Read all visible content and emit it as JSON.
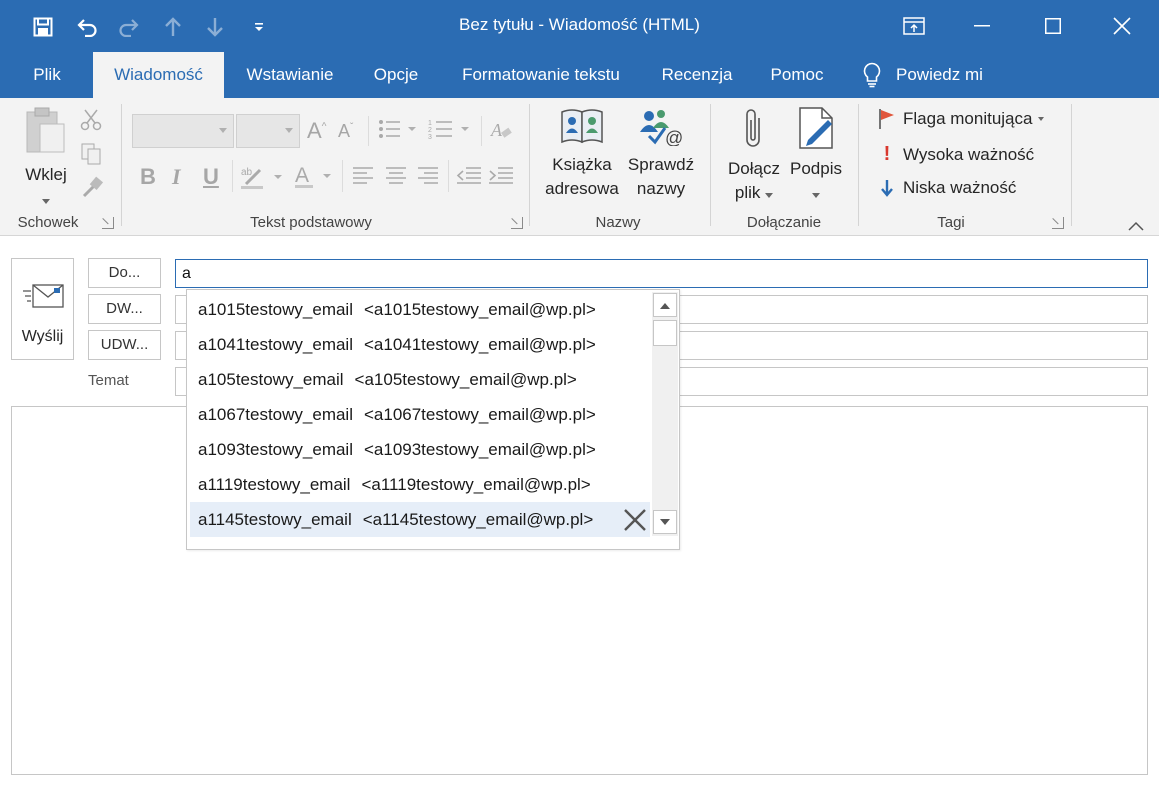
{
  "window": {
    "title": "Bez tytułu  -  Wiadomość (HTML)"
  },
  "tabs": [
    "Plik",
    "Wiadomość",
    "Wstawianie",
    "Opcje",
    "Formatowanie tekstu",
    "Recenzja",
    "Pomoc"
  ],
  "active_tab": "Wiadomość",
  "tell_me": "Powiedz mi",
  "ribbon": {
    "clipboard": {
      "paste": "Wklej",
      "group": "Schowek"
    },
    "basic_text": {
      "group": "Tekst podstawowy"
    },
    "names": {
      "address_book_1": "Książka",
      "address_book_2": "adresowa",
      "check_names_1": "Sprawdź",
      "check_names_2": "nazwy",
      "group": "Nazwy"
    },
    "include": {
      "attach_1": "Dołącz",
      "attach_2": "plik",
      "signature": "Podpis",
      "group": "Dołączanie"
    },
    "tags": {
      "follow_up": "Flaga monitująca",
      "high": "Wysoka ważność",
      "low": "Niska ważność",
      "group": "Tagi"
    }
  },
  "compose": {
    "send": "Wyślij",
    "to_btn": "Do...",
    "cc_btn": "DW...",
    "bcc_btn": "UDW...",
    "subject_label": "Temat",
    "to_value": "a"
  },
  "autocomplete": [
    {
      "name": "a1015testowy_email",
      "email": "<a1015testowy_email@wp.pl>"
    },
    {
      "name": "a1041testowy_email",
      "email": "<a1041testowy_email@wp.pl>"
    },
    {
      "name": "a105testowy_email",
      "email": "<a105testowy_email@wp.pl>"
    },
    {
      "name": "a1067testowy_email",
      "email": "<a1067testowy_email@wp.pl>"
    },
    {
      "name": "a1093testowy_email",
      "email": "<a1093testowy_email@wp.pl>"
    },
    {
      "name": "a1119testowy_email",
      "email": "<a1119testowy_email@wp.pl>"
    },
    {
      "name": "a1145testowy_email",
      "email": "<a1145testowy_email@wp.pl>"
    }
  ],
  "colors": {
    "accent": "#2b6cb3",
    "ribbon": "#f3f3f3",
    "selection": "#e6eef8",
    "flag": "#e0553b",
    "high": "#d9382e",
    "low": "#2b6cb3"
  },
  "icons": [
    "save-icon",
    "undo-icon",
    "redo-icon",
    "up-icon",
    "down-icon",
    "customize-icon",
    "ribbon-display-icon",
    "minimize-icon",
    "maximize-icon",
    "close-icon",
    "lightbulb-icon"
  ]
}
